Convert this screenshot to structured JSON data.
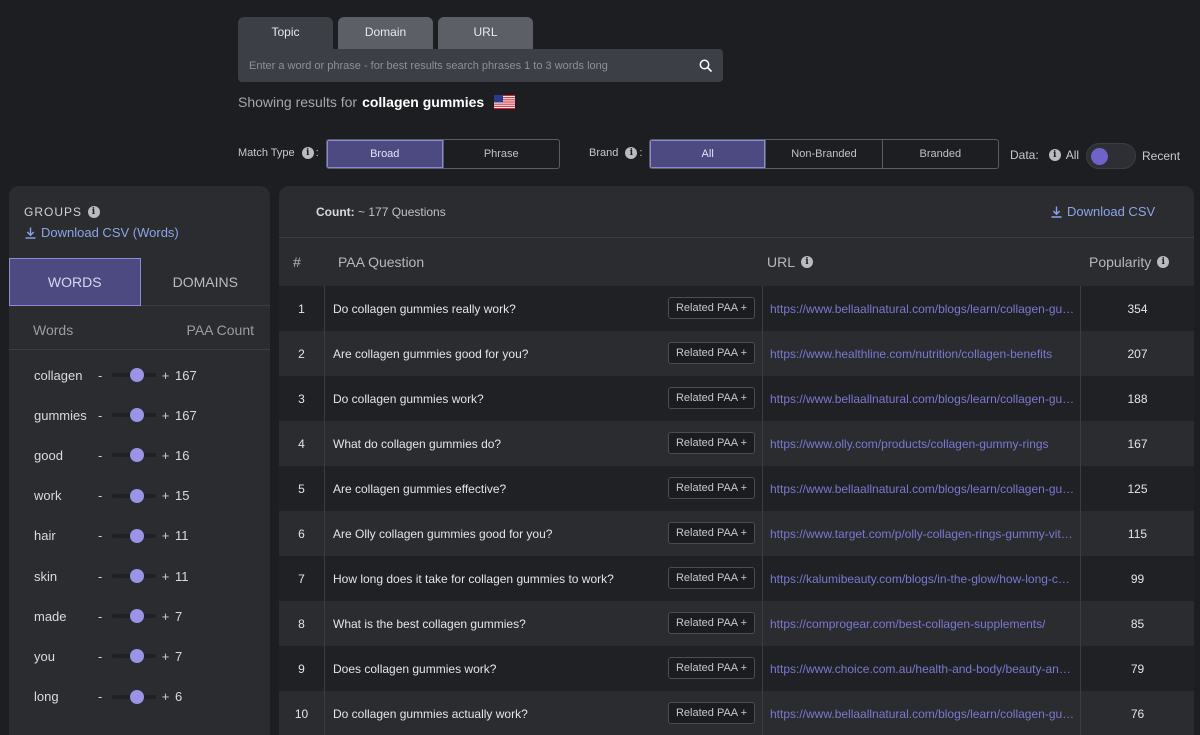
{
  "search": {
    "tabs": [
      "Topic",
      "Domain",
      "URL"
    ],
    "placeholder": "Enter a word or phrase - for best results search phrases 1 to 3 words long",
    "showing_prefix": "Showing results for",
    "keyword": "collagen gummies"
  },
  "filters": {
    "match_type_label": "Match Type",
    "match_options": [
      "Broad",
      "Phrase"
    ],
    "brand_label": "Brand",
    "brand_options": [
      "All",
      "Non-Branded",
      "Branded"
    ],
    "data_label": "Data:",
    "data_all": "All",
    "data_recent": "Recent"
  },
  "groups": {
    "title": "GROUPS",
    "download_label": "Download CSV (Words)",
    "tabs": [
      "WORDS",
      "DOMAINS"
    ],
    "col_words": "Words",
    "col_count": "PAA Count",
    "minus": "-",
    "plus": "+",
    "words": [
      {
        "word": "collagen",
        "count": "167"
      },
      {
        "word": "gummies",
        "count": "167"
      },
      {
        "word": "good",
        "count": "16"
      },
      {
        "word": "work",
        "count": "15"
      },
      {
        "word": "hair",
        "count": "11"
      },
      {
        "word": "skin",
        "count": "11"
      },
      {
        "word": "made",
        "count": "7"
      },
      {
        "word": "you",
        "count": "7"
      },
      {
        "word": "long",
        "count": "6"
      }
    ]
  },
  "results": {
    "count_label": "Count:",
    "count_value": "~ 177 Questions",
    "download_label": "Download CSV",
    "columns": {
      "num": "#",
      "question": "PAA Question",
      "url": "URL",
      "popularity": "Popularity"
    },
    "related_label": "Related PAA +",
    "rows": [
      {
        "n": "1",
        "q": "Do collagen gummies really work?",
        "url": "https://www.bellaallnatural.com/blogs/learn/collagen-gummies",
        "pop": "354"
      },
      {
        "n": "2",
        "q": "Are collagen gummies good for you?",
        "url": "https://www.healthline.com/nutrition/collagen-benefits",
        "pop": "207"
      },
      {
        "n": "3",
        "q": "Do collagen gummies work?",
        "url": "https://www.bellaallnatural.com/blogs/learn/collagen-gummies",
        "pop": "188"
      },
      {
        "n": "4",
        "q": "What do collagen gummies do?",
        "url": "https://www.olly.com/products/collagen-gummy-rings",
        "pop": "167"
      },
      {
        "n": "5",
        "q": "Are collagen gummies effective?",
        "url": "https://www.bellaallnatural.com/blogs/learn/collagen-gummies",
        "pop": "125"
      },
      {
        "n": "6",
        "q": "Are Olly collagen gummies good for you?",
        "url": "https://www.target.com/p/olly-collagen-rings-gummy-vitamins",
        "pop": "115"
      },
      {
        "n": "7",
        "q": "How long does it take for collagen gummies to work?",
        "url": "https://kalumibeauty.com/blogs/in-the-glow/how-long-collagen",
        "pop": "99"
      },
      {
        "n": "8",
        "q": "What is the best collagen gummies?",
        "url": "https://comprogear.com/best-collagen-supplements/",
        "pop": "85"
      },
      {
        "n": "9",
        "q": "Does collagen gummies work?",
        "url": "https://www.choice.com.au/health-and-body/beauty-and-personal-care",
        "pop": "79"
      },
      {
        "n": "10",
        "q": "Do collagen gummies actually work?",
        "url": "https://www.bellaallnatural.com/blogs/learn/collagen-gummies",
        "pop": "76"
      }
    ]
  }
}
